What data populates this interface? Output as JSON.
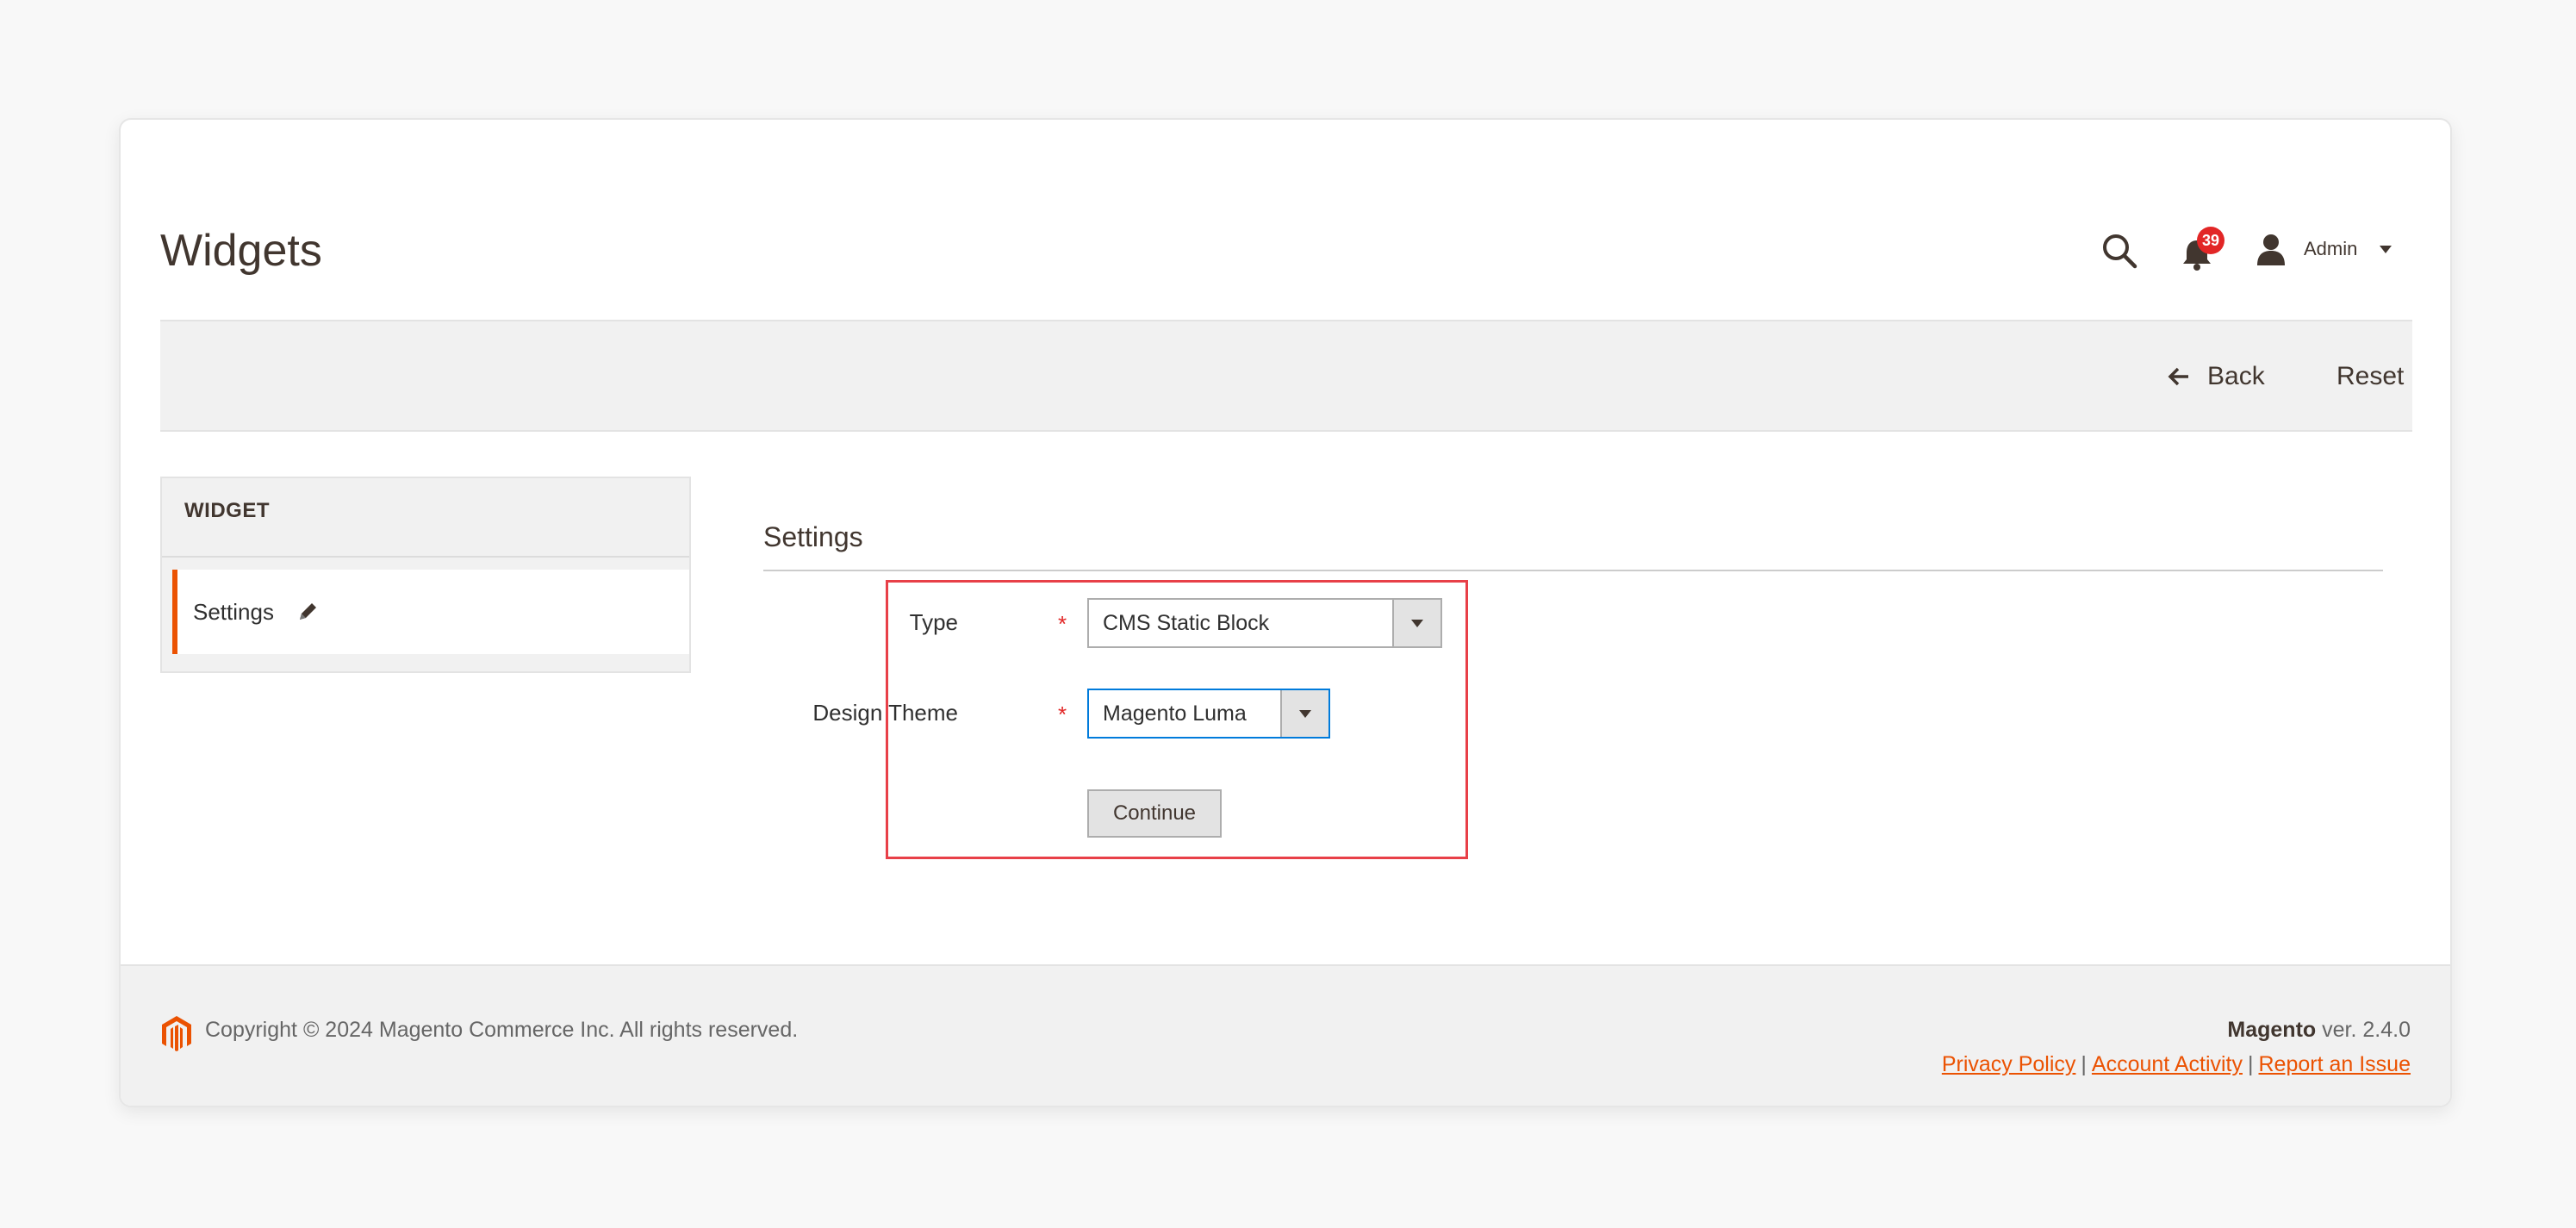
{
  "header": {
    "title": "Widgets",
    "notifications_count": "39",
    "user_name": "Admin"
  },
  "actions": {
    "back_label": "Back",
    "reset_label": "Reset"
  },
  "sidebar": {
    "title": "WIDGET",
    "items": [
      {
        "label": "Settings",
        "active": true
      }
    ]
  },
  "settings": {
    "title": "Settings",
    "fields": {
      "type": {
        "label": "Type",
        "required_mark": "*",
        "value": "CMS Static Block"
      },
      "theme": {
        "label": "Design Theme",
        "required_mark": "*",
        "value": "Magento Luma"
      }
    },
    "continue_label": "Continue"
  },
  "footer": {
    "copyright": "Copyright © 2024 Magento Commerce Inc. All rights reserved.",
    "brand": "Magento",
    "version": "ver. 2.4.0",
    "links": {
      "privacy": "Privacy Policy",
      "activity": "Account Activity",
      "report": "Report an Issue",
      "separator": "|"
    }
  },
  "colors": {
    "accent": "#eb5202",
    "badge": "#e22626",
    "highlight_border": "#e84048",
    "focus_border": "#007bdb"
  },
  "icons": [
    "search-icon",
    "bell-icon",
    "user-icon",
    "chevron-down-icon",
    "arrow-left-icon",
    "pencil-icon",
    "magento-logo-icon"
  ]
}
